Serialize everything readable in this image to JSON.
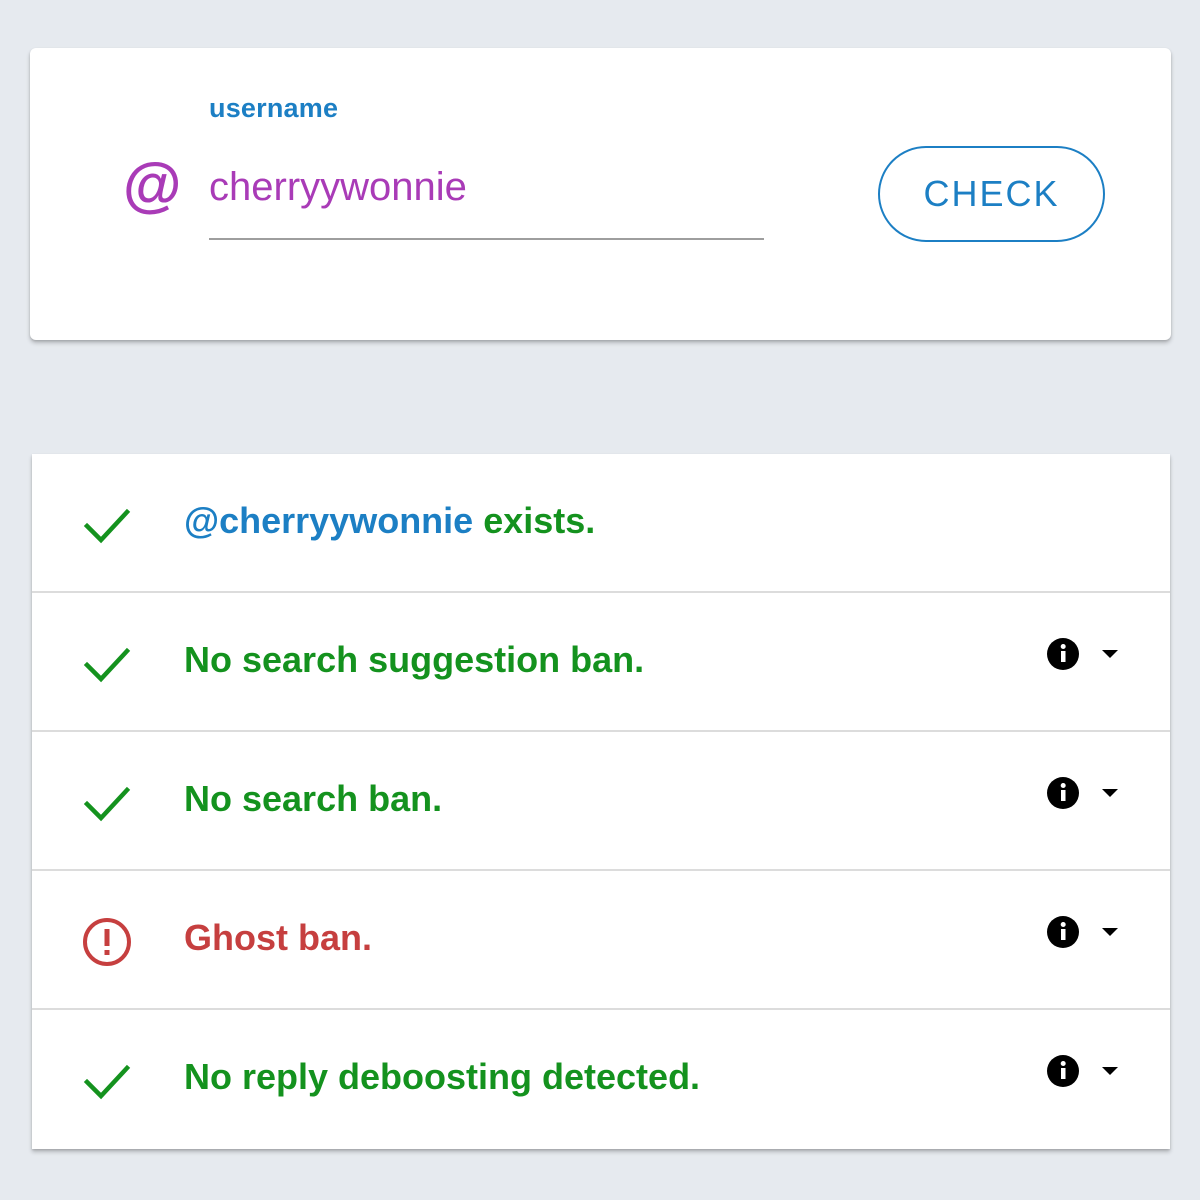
{
  "search": {
    "label": "username",
    "at_symbol": "@",
    "value": "cherryywonnie",
    "button_label": "CHECK"
  },
  "results": [
    {
      "status": "ok",
      "icon": "check-icon",
      "handle": "@cherryywonnie",
      "text": " exists.",
      "has_info": false
    },
    {
      "status": "ok",
      "icon": "check-icon",
      "text": "No search suggestion ban.",
      "has_info": true
    },
    {
      "status": "ok",
      "icon": "check-icon",
      "text": "No search ban.",
      "has_info": true
    },
    {
      "status": "bad",
      "icon": "alert-circle-icon",
      "text": "Ghost ban.",
      "has_info": true
    },
    {
      "status": "ok",
      "icon": "check-icon",
      "text": "No reply deboosting detected.",
      "has_info": true
    }
  ],
  "colors": {
    "background": "#e6eaef",
    "accent": "#1c7fc4",
    "handle_purple": "#a93bb7",
    "ok_green": "#14921e",
    "error_red": "#c63f3f"
  }
}
